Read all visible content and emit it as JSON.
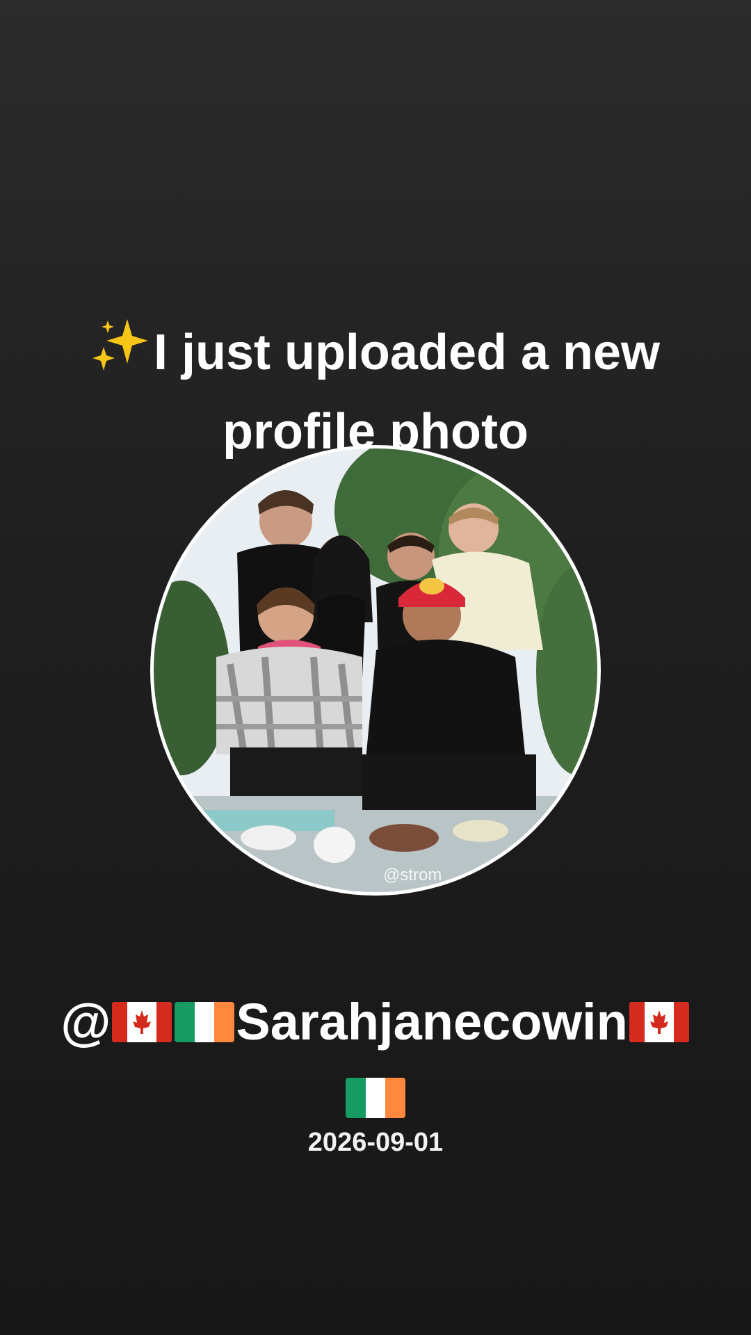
{
  "headline": {
    "icon": "sparkles-icon",
    "text": "I just uploaded a new profile photo"
  },
  "profile_photo": {
    "watermark": "@strom"
  },
  "user": {
    "prefix": "@",
    "name": "Sarahjanecowin",
    "flags_before": [
      "canada-flag-icon",
      "ireland-flag-icon"
    ],
    "flags_after": [
      "canada-flag-icon",
      "ireland-flag-icon"
    ]
  },
  "date": "2026-09-01",
  "colors": {
    "background_top": "#2b2b2b",
    "background_bottom": "#171717",
    "text": "#ffffff",
    "sparkle": "#f5c518",
    "canada_red": "#d52b1e",
    "ireland_green": "#169b62",
    "ireland_orange": "#ff883e"
  }
}
